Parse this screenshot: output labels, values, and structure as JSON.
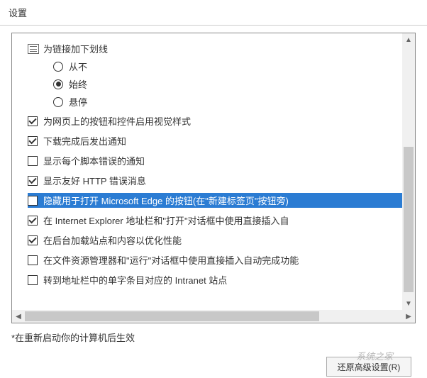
{
  "title": "设置",
  "group": {
    "label": "为链接加下划线",
    "radios": [
      {
        "label": "从不",
        "selected": false
      },
      {
        "label": "始终",
        "selected": true
      },
      {
        "label": "悬停",
        "selected": false
      }
    ]
  },
  "checkboxes": [
    {
      "label": "为网页上的按钮和控件启用视觉样式",
      "checked": true,
      "highlighted": false
    },
    {
      "label": "下载完成后发出通知",
      "checked": true,
      "highlighted": false
    },
    {
      "label": "显示每个脚本错误的通知",
      "checked": false,
      "highlighted": false
    },
    {
      "label": "显示友好 HTTP 错误消息",
      "checked": true,
      "highlighted": false
    },
    {
      "label": "隐藏用于打开 Microsoft Edge 的按钮(在\"新建标签页\"按钮旁)",
      "checked": false,
      "highlighted": true
    },
    {
      "label": "在 Internet Explorer 地址栏和\"打开\"对话框中使用直接插入自",
      "checked": true,
      "highlighted": false
    },
    {
      "label": "在后台加载站点和内容以优化性能",
      "checked": true,
      "highlighted": false
    },
    {
      "label": "在文件资源管理器和\"运行\"对话框中使用直接插入自动完成功能",
      "checked": false,
      "highlighted": false
    },
    {
      "label": "转到地址栏中的单字条目对应的 Intranet 站点",
      "checked": false,
      "highlighted": false
    }
  ],
  "footer_note": "*在重新启动你的计算机后生效",
  "buttons": {
    "restore": "还原高级设置(R)"
  },
  "watermark": "系统之家"
}
